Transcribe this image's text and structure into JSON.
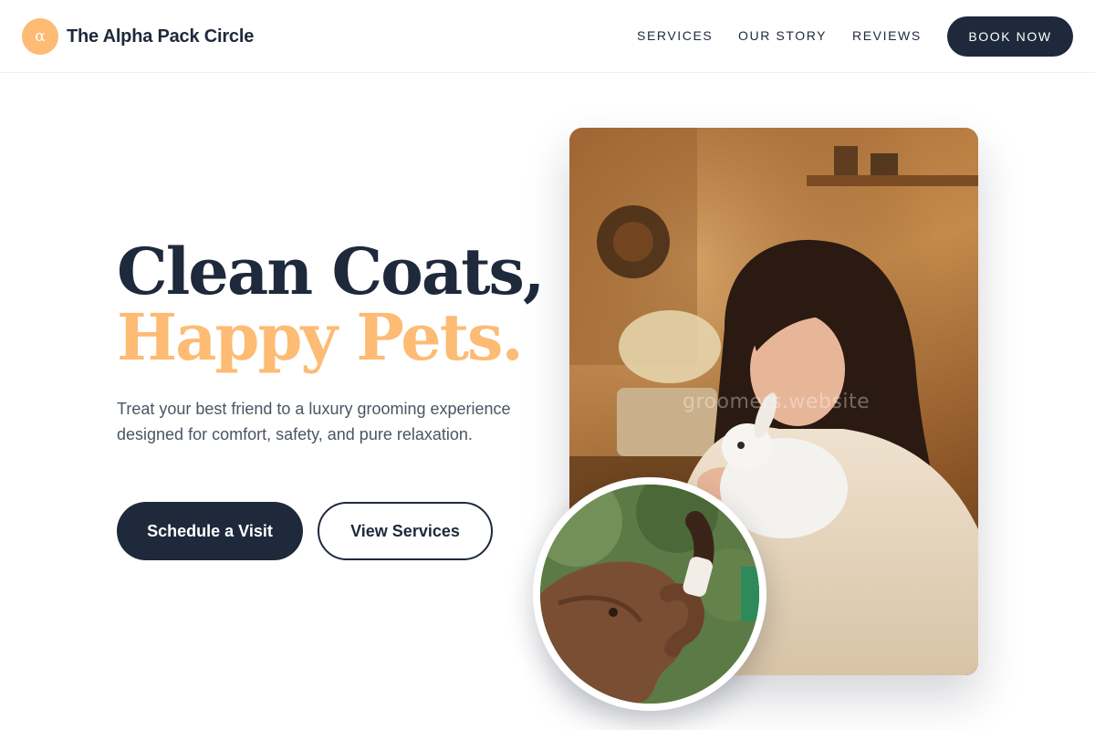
{
  "header": {
    "logo_symbol": "α",
    "brand_name": "The Alpha Pack Circle",
    "nav": [
      {
        "label": "SERVICES"
      },
      {
        "label": "OUR STORY"
      },
      {
        "label": "REVIEWS"
      }
    ],
    "cta_label": "BOOK NOW"
  },
  "hero": {
    "headline_line1": "Clean Coats,",
    "headline_line2": "Happy Pets.",
    "subtext": "Treat your best friend to a luxury grooming experience designed for comfort, safety, and pure relaxation.",
    "primary_button": "Schedule a Visit",
    "secondary_button": "View Services"
  },
  "media": {
    "main_photo_watermark": "groomers.website",
    "main_photo_subject": "woman-holding-white-rabbit",
    "circle_photo_subject": "baby-elephant-bottle-feeding"
  },
  "colors": {
    "navy": "#1e293b",
    "accent": "#fdbb74",
    "body_text": "#4b5563"
  }
}
